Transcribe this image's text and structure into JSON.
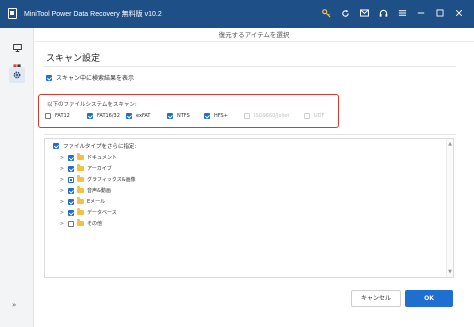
{
  "titlebar": {
    "title": "MiniTool Power Data Recovery 無料版 v10.2",
    "icons": [
      "key-icon",
      "refresh-icon",
      "email-icon",
      "headset-icon",
      "menu-icon",
      "minimize-icon",
      "maximize-icon",
      "close-icon"
    ]
  },
  "sidebar": {
    "items": [
      "scan-icon",
      "apps-icon",
      "settings-icon"
    ],
    "bottom_icon": "expand-icon",
    "bottom_glyph": "»"
  },
  "panel": {
    "title": "復元するアイテムを選択"
  },
  "scan_settings": {
    "title": "スキャン設定",
    "show_results_label": "スキャン中に検索結果を表示",
    "show_results_checked": true
  },
  "filesystems": {
    "label": "以下のファイルシステムをスキャン:",
    "items": [
      {
        "label": "FAT12",
        "checked": false,
        "disabled": false
      },
      {
        "label": "FAT16/32",
        "checked": true,
        "disabled": false
      },
      {
        "label": "exFAT",
        "checked": true,
        "disabled": false
      },
      {
        "label": "NTFS",
        "checked": true,
        "disabled": false
      },
      {
        "label": "HFS+",
        "checked": true,
        "disabled": false
      },
      {
        "label": "ISO9660/Joliet",
        "checked": false,
        "disabled": true
      },
      {
        "label": "UDF",
        "checked": false,
        "disabled": true
      }
    ]
  },
  "filetypes": {
    "label": "ファイルタイプをさらに指定:",
    "items": [
      {
        "label": "ドキュメント",
        "state": "checked"
      },
      {
        "label": "アーカイブ",
        "state": "checked"
      },
      {
        "label": "グラフィックス&画像",
        "state": "partial"
      },
      {
        "label": "音声&動画",
        "state": "checked"
      },
      {
        "label": "Eメール",
        "state": "checked"
      },
      {
        "label": "データベース",
        "state": "checked"
      },
      {
        "label": "その他",
        "state": "unchecked"
      }
    ]
  },
  "buttons": {
    "cancel": "キャンセル",
    "ok": "OK"
  },
  "colors": {
    "titlebar": "#1f4f87",
    "accent": "#1e6fd0",
    "highlight_border": "#d93a2b",
    "folder": "#f3c244"
  }
}
